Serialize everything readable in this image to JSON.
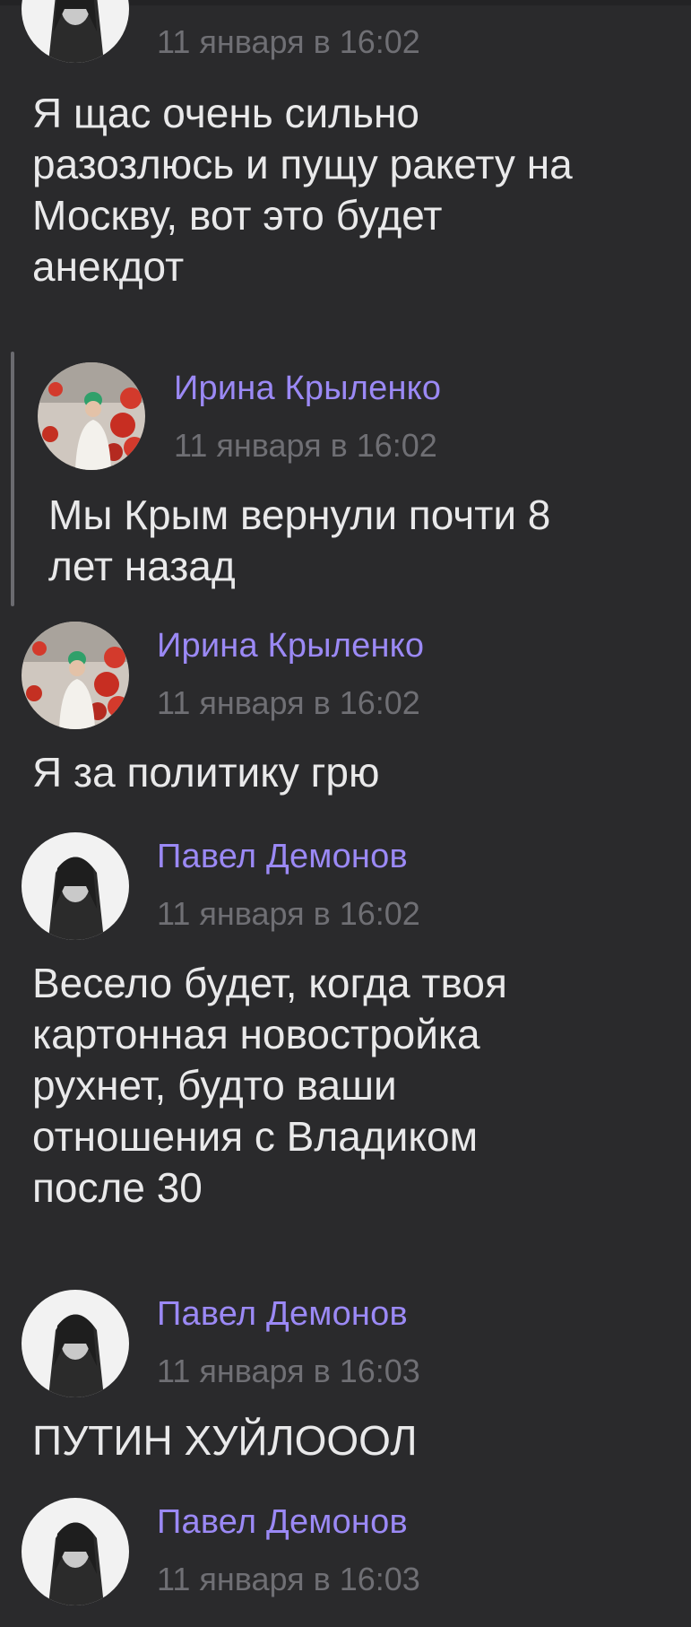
{
  "messages": [
    {
      "id": "m0",
      "avatar_icon": "pavel-avatar-icon",
      "time": "11 января в 16:02",
      "text": "Я щас очень сильно\nразозлюсь и пущу ракету на\nМоскву, вот это будет\nанекдот"
    },
    {
      "id": "m1",
      "quoted": true,
      "author": "Ирина Крыленко",
      "avatar_icon": "irina-avatar-icon",
      "time": "11 января в 16:02",
      "text": "Мы Крым вернули почти 8\nлет назад"
    },
    {
      "id": "m2",
      "author": "Ирина Крыленко",
      "avatar_icon": "irina-avatar-icon",
      "time": "11 января в 16:02",
      "text": "Я за политику грю"
    },
    {
      "id": "m3",
      "author": "Павел Демонов",
      "avatar_icon": "pavel-avatar-icon",
      "time": "11 января в 16:02",
      "text": "Весело будет, когда твоя\nкартонная новостройка\nрухнет, будто ваши\nотношения с Владиком\nпосле 30"
    },
    {
      "id": "m4",
      "author": "Павел Демонов",
      "avatar_icon": "pavel-avatar-icon",
      "time": "11 января в 16:03",
      "text": "ПУТИН ХУЙЛОООЛ"
    },
    {
      "id": "m5",
      "author": "Павел Демонов",
      "avatar_icon": "pavel-avatar-icon",
      "time": "11 января в 16:03",
      "text": ""
    }
  ],
  "colors": {
    "background": "#2a2a2c",
    "author_name": "#9b89f5",
    "timestamp": "#6f6f74",
    "message_text": "#e9e9ea",
    "quote_bar": "#6b6b70"
  }
}
